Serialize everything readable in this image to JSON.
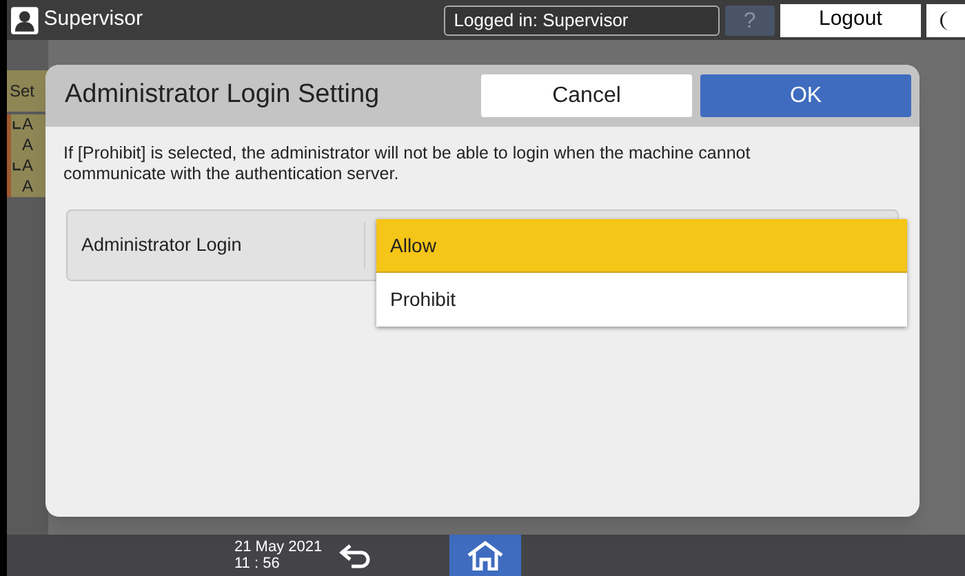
{
  "top_bar": {
    "user": "Supervisor",
    "login_status": "Logged in: Supervisor",
    "help": "?",
    "logout": "Logout"
  },
  "background": {
    "sidebar_items": [
      {
        "label": "Set",
        "kind": "header"
      },
      {
        "label": "A",
        "kind": "sub"
      },
      {
        "label": "A",
        "kind": "plain"
      },
      {
        "label": "A",
        "kind": "sub"
      },
      {
        "label": "A",
        "kind": "plain"
      }
    ]
  },
  "dialog": {
    "title": "Administrator Login Setting",
    "buttons": [
      {
        "label": "Cancel",
        "kind": "secondary"
      },
      {
        "label": "OK",
        "kind": "primary"
      }
    ],
    "message": "If [Prohibit] is selected, the administrator will not be able to login when the machine cannot communicate with the authentication server.",
    "setting": {
      "label": "Administrator Login",
      "options": [
        {
          "label": "Allow",
          "selected": true
        },
        {
          "label": "Prohibit",
          "selected": false
        }
      ]
    }
  },
  "bottom_bar": {
    "date": "21 May 2021",
    "time": "11 : 56"
  }
}
